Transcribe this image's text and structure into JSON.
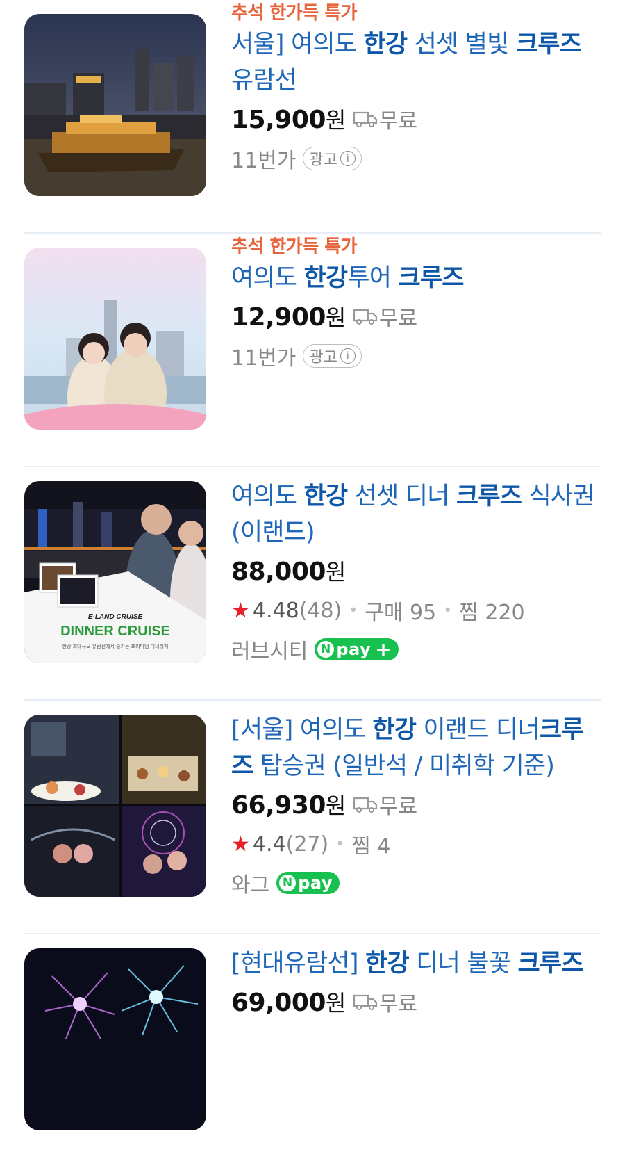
{
  "products": [
    {
      "promo": "추석 한가득 특가",
      "title_parts": [
        {
          "t": "서울] 여의도 ",
          "b": false
        },
        {
          "t": "한강",
          "b": true
        },
        {
          "t": " 선셋 별빛 ",
          "b": false
        },
        {
          "t": "크루즈",
          "b": true
        },
        {
          "t": " 유람선",
          "b": false
        }
      ],
      "price": "15,900",
      "currency": "원",
      "shipping": "무료",
      "seller": "11번가",
      "ad_label": "광고",
      "ad_info": "i",
      "image": "night-cruise-boat"
    },
    {
      "promo": "추석 한가득 특가",
      "title_parts": [
        {
          "t": "여의도 ",
          "b": false
        },
        {
          "t": "한강",
          "b": true
        },
        {
          "t": "투어 ",
          "b": false
        },
        {
          "t": "크루즈",
          "b": true
        }
      ],
      "price": "12,900",
      "currency": "원",
      "shipping": "무료",
      "seller": "11번가",
      "ad_label": "광고",
      "ad_info": "i",
      "image": "couple-river-photo"
    },
    {
      "title_parts": [
        {
          "t": "여의도 ",
          "b": false
        },
        {
          "t": "한강",
          "b": true
        },
        {
          "t": " 선셋 디너 ",
          "b": false
        },
        {
          "t": "크루즈",
          "b": true
        },
        {
          "t": " 식사권(이랜드)",
          "b": false
        }
      ],
      "price": "88,000",
      "currency": "원",
      "rating": "4.48",
      "reviews": "(48)",
      "purchases": "구매 95",
      "wishes": "찜 220",
      "seller": "러브시티",
      "npay": "pay",
      "image_caption_brand": "E·LAND CRUISE",
      "image_caption_title": "DINNER CRUISE",
      "image_caption_sub": "한강 최대규모 유람선에서 즐기는 프리미엄 디너뷔페"
    },
    {
      "title_parts": [
        {
          "t": "[서울] 여의도 ",
          "b": false
        },
        {
          "t": "한강",
          "b": true
        },
        {
          "t": " 이랜드 디너",
          "b": false
        },
        {
          "t": "크루즈",
          "b": true
        },
        {
          "t": " 탑승권 (일반석 / 미취학 기준)",
          "b": false
        }
      ],
      "price": "66,930",
      "currency": "원",
      "shipping": "무료",
      "rating": "4.4",
      "reviews": "(27)",
      "wishes": "찜 4",
      "seller": "와그",
      "npay": "pay",
      "image": "dinner-cruise-collage"
    },
    {
      "title_parts": [
        {
          "t": "[현대유람선] ",
          "b": false
        },
        {
          "t": "한강",
          "b": true
        },
        {
          "t": " 디너 불꽃 ",
          "b": false
        },
        {
          "t": "크루즈",
          "b": true
        }
      ],
      "price": "69,000",
      "currency": "원",
      "shipping": "무료",
      "image": "fireworks"
    }
  ]
}
